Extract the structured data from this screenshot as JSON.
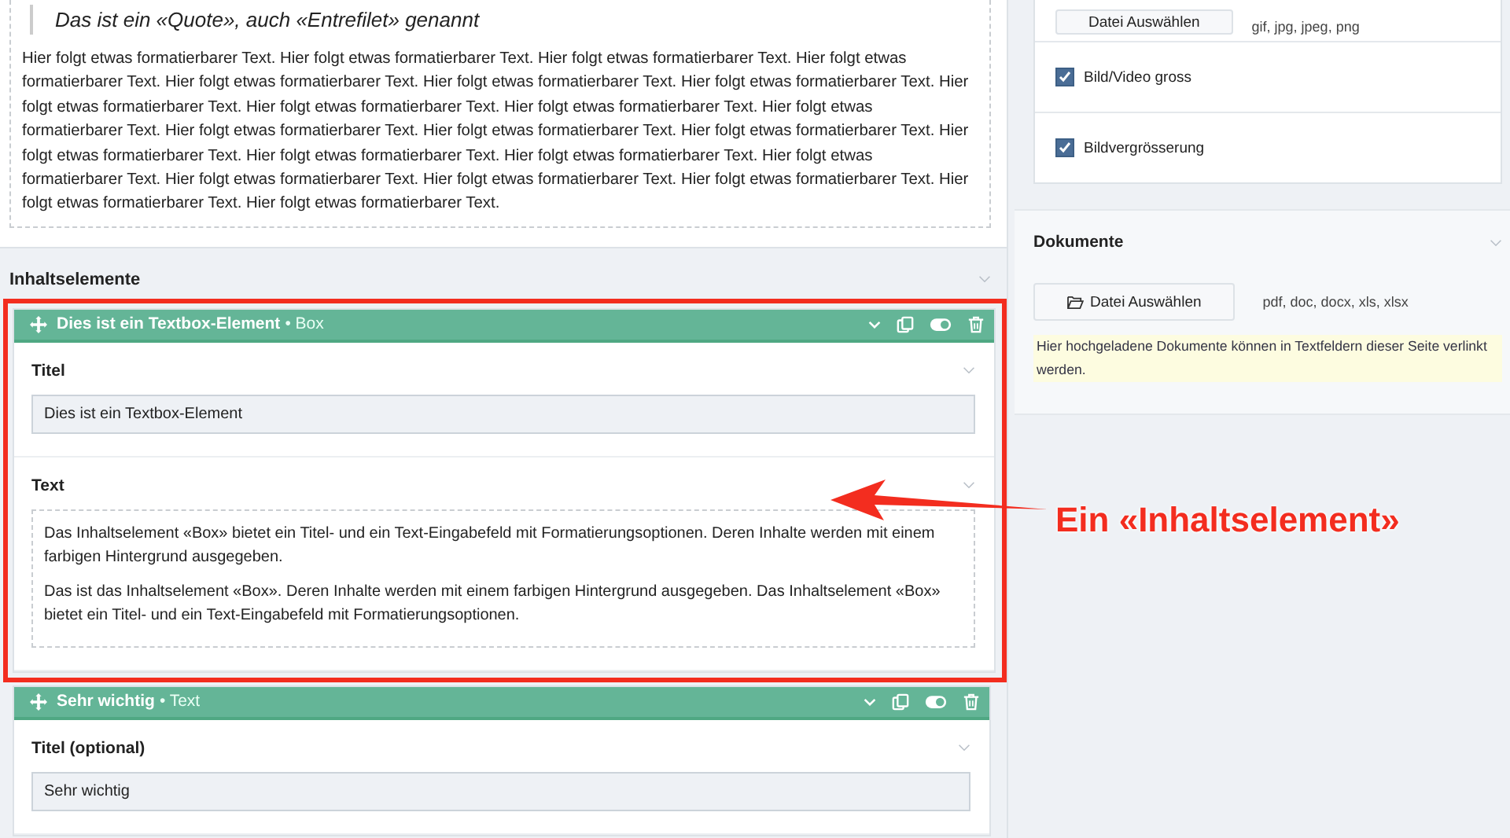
{
  "upper_text_block": {
    "quote": "Das ist ein «Quote», auch «Entrefilet» genannt",
    "paragraph": "Hier folgt etwas formatierbarer Text. Hier folgt etwas formatierbarer Text. Hier folgt etwas formatierbarer Text. Hier folgt etwas formatierbarer Text. Hier folgt etwas formatierbarer Text. Hier folgt etwas formatierbarer Text. Hier folgt etwas formatierbarer Text. Hier folgt etwas formatierbarer Text. Hier folgt etwas formatierbarer Text. Hier folgt etwas formatierbarer Text. Hier folgt etwas formatierbarer Text. Hier folgt etwas formatierbarer Text. Hier folgt etwas formatierbarer Text. Hier folgt etwas formatierbarer Text. Hier folgt etwas formatierbarer Text. Hier folgt etwas formatierbarer Text. Hier folgt etwas formatierbarer Text. Hier folgt etwas formatierbarer Text. Hier folgt etwas formatierbarer Text. Hier folgt etwas formatierbarer Text. Hier folgt etwas formatierbarer Text. Hier folgt etwas formatierbarer Text. Hier folgt etwas formatierbarer Text."
  },
  "content_elements": {
    "title": "Inhaltselemente",
    "elements": [
      {
        "name": "Dies ist ein Textbox-Element",
        "type": "• Box",
        "highlighted": true,
        "fields": [
          {
            "kind": "input",
            "label": "Titel",
            "value": "Dies ist ein Textbox-Element"
          },
          {
            "kind": "richtext",
            "label": "Text",
            "paragraphs": [
              "Das Inhaltselement «Box» bietet ein Titel- und ein Text-Eingabefeld mit Formatierungsoptionen. Deren Inhalte werden mit einem farbigen Hintergrund ausgegeben.",
              "Das ist das Inhaltselement «Box». Deren Inhalte werden mit einem farbigen Hintergrund ausgegeben. Das Inhaltselement «Box» bietet ein Titel- und ein Text-Eingabefeld mit Formatierungsoptionen."
            ]
          }
        ]
      },
      {
        "name": "Sehr wichtig",
        "type": "• Text",
        "highlighted": false,
        "fields": [
          {
            "kind": "input",
            "label": "Titel (optional)",
            "value": "Sehr wichtig"
          }
        ]
      }
    ]
  },
  "media_panel": {
    "button": "Datei Auswählen",
    "formats": "gif, jpg, jpeg, png",
    "options": [
      {
        "label": "Bild/Video gross",
        "checked": true
      },
      {
        "label": "Bildvergrösserung",
        "checked": true
      }
    ]
  },
  "documents": {
    "title": "Dokumente",
    "button": "Datei Auswählen",
    "formats": "pdf, doc, docx, xls, xlsx",
    "note": "Hier hochgeladene Dokumente können in Textfeldern dieser Seite verlinkt werden."
  },
  "annotation": {
    "label": "Ein «Inhaltselement»"
  }
}
